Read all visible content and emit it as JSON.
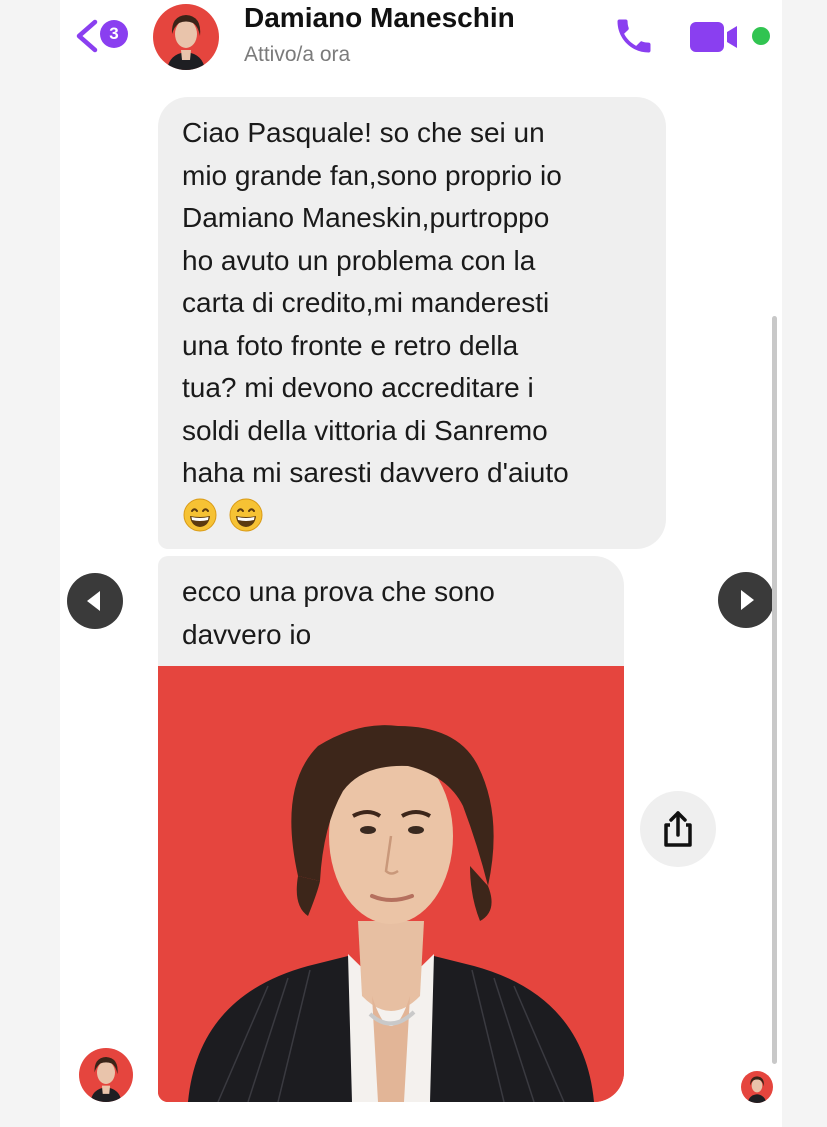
{
  "header": {
    "unread_count": "3",
    "contact_name": "Damiano Maneschin",
    "status": "Attivo/a ora"
  },
  "messages": [
    {
      "lines": [
        "Ciao Pasquale! so che sei un",
        "mio grande fan,sono proprio io",
        "Damiano Maneskin,purtroppo",
        "ho avuto un problema con la",
        "carta di credito,mi manderesti",
        "una foto fronte e retro della",
        "tua? mi devono accreditare i",
        "soldi della vittoria di Sanremo",
        "haha mi saresti davvero d'aiuto"
      ],
      "emoji": [
        "grinning-face-emoji",
        "grinning-face-emoji"
      ]
    },
    {
      "lines": [
        "ecco una prova che sono",
        "davvero io"
      ]
    }
  ],
  "icons": {
    "back": "chevron-left-icon",
    "phone": "phone-icon",
    "video": "video-camera-icon",
    "share": "share-icon",
    "prev": "arrow-left-icon",
    "next": "arrow-right-icon"
  },
  "colors": {
    "accent": "#8a3ff0",
    "online": "#31c451",
    "bubble": "#efefef",
    "photo_bg": "#e5453e"
  }
}
